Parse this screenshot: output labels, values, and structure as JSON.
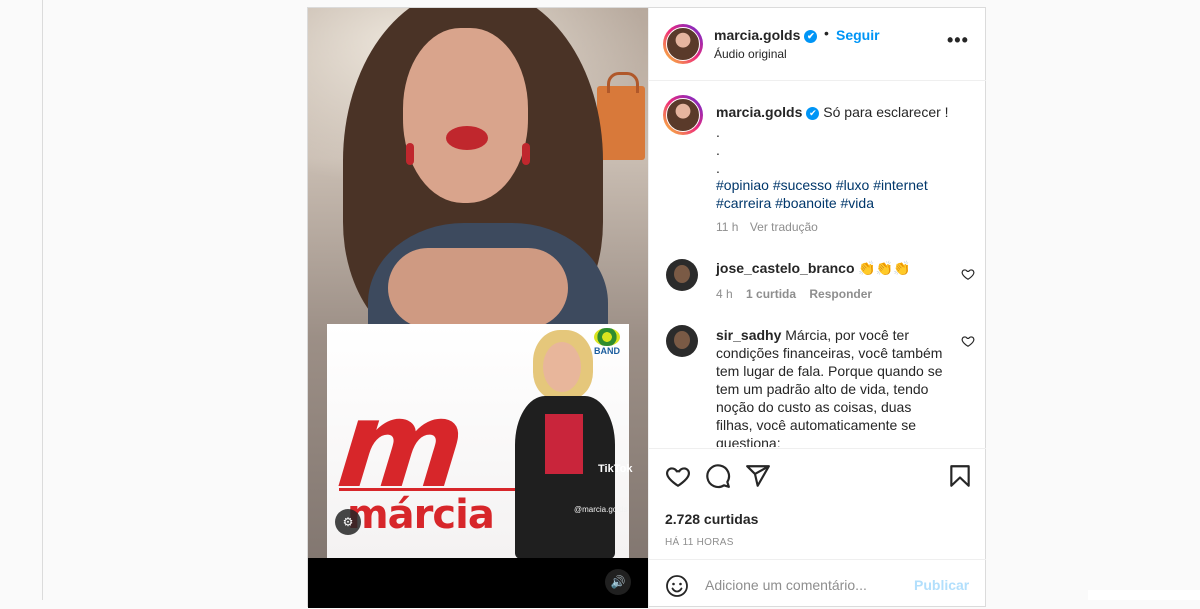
{
  "post": {
    "username": "marcia.golds",
    "verified_mark": "✔",
    "separator": "•",
    "follow_label": "Seguir",
    "audio_label": "Áudio original",
    "more_icon": "more-options-icon"
  },
  "media": {
    "overlay_brand_letter": "m",
    "overlay_brand_word": "márcia",
    "overlay_channel": "BAND",
    "watermark_app": "TikTok",
    "watermark_user": "@marcia.golds",
    "left_control_glyph": "⚙",
    "sound_glyph": "🔊"
  },
  "caption": {
    "username": "marcia.golds",
    "text": "Só para esclarecer !",
    "dots": [
      ".",
      ".",
      "."
    ],
    "hashtags": "#opiniao #sucesso #luxo #internet #carreira #boanoite #vida",
    "time": "11 h",
    "translate_label": "Ver tradução"
  },
  "comments": [
    {
      "username": "jose_castelo_branco",
      "text": "👏👏👏",
      "time": "4 h",
      "likes": "1 curtida",
      "reply_label": "Responder"
    },
    {
      "username": "sir_sadhy",
      "text": "Márcia, por você ter condições financeiras, você também tem lugar de fala. Porque quando se tem um padrão alto de vida, tendo noção do custo as coisas, duas filhas, você automaticamente se questiona:"
    }
  ],
  "stats": {
    "likes": "2.728 curtidas",
    "posted_ago": "HÁ 11 HORAS"
  },
  "composer": {
    "placeholder": "Adicione um comentário...",
    "publish_label": "Publicar"
  }
}
